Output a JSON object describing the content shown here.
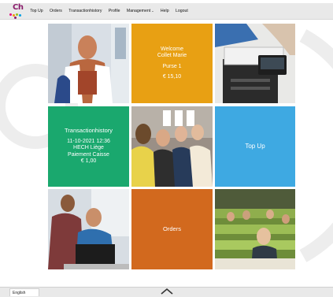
{
  "nav": {
    "items": [
      {
        "label": "Top Up"
      },
      {
        "label": "Orders"
      },
      {
        "label": "Transactionhistory"
      },
      {
        "label": "Profile"
      },
      {
        "label": "Management"
      },
      {
        "label": "Help"
      },
      {
        "label": "Logout"
      }
    ],
    "management_caret": "⌄"
  },
  "logo": {
    "text": "Ch"
  },
  "welcome": {
    "line1": "Welcome",
    "line2": "Collet Marie",
    "purse": "Purse 1",
    "amount": "€ 15,10"
  },
  "transaction": {
    "title": "Transactionhistory",
    "datetime": "11-10-2021 12:36",
    "place": "HECH Liège",
    "method": "Paiement Caisse",
    "amount": "€ 1,00"
  },
  "topup": {
    "label": "Top Up"
  },
  "orders": {
    "label": "Orders"
  },
  "footer": {
    "language": "English"
  },
  "colors": {
    "welcome_tile": "#e8a013",
    "transaction_tile": "#1aa86e",
    "topup_tile": "#3ea9e2",
    "orders_tile": "#d2691e"
  }
}
